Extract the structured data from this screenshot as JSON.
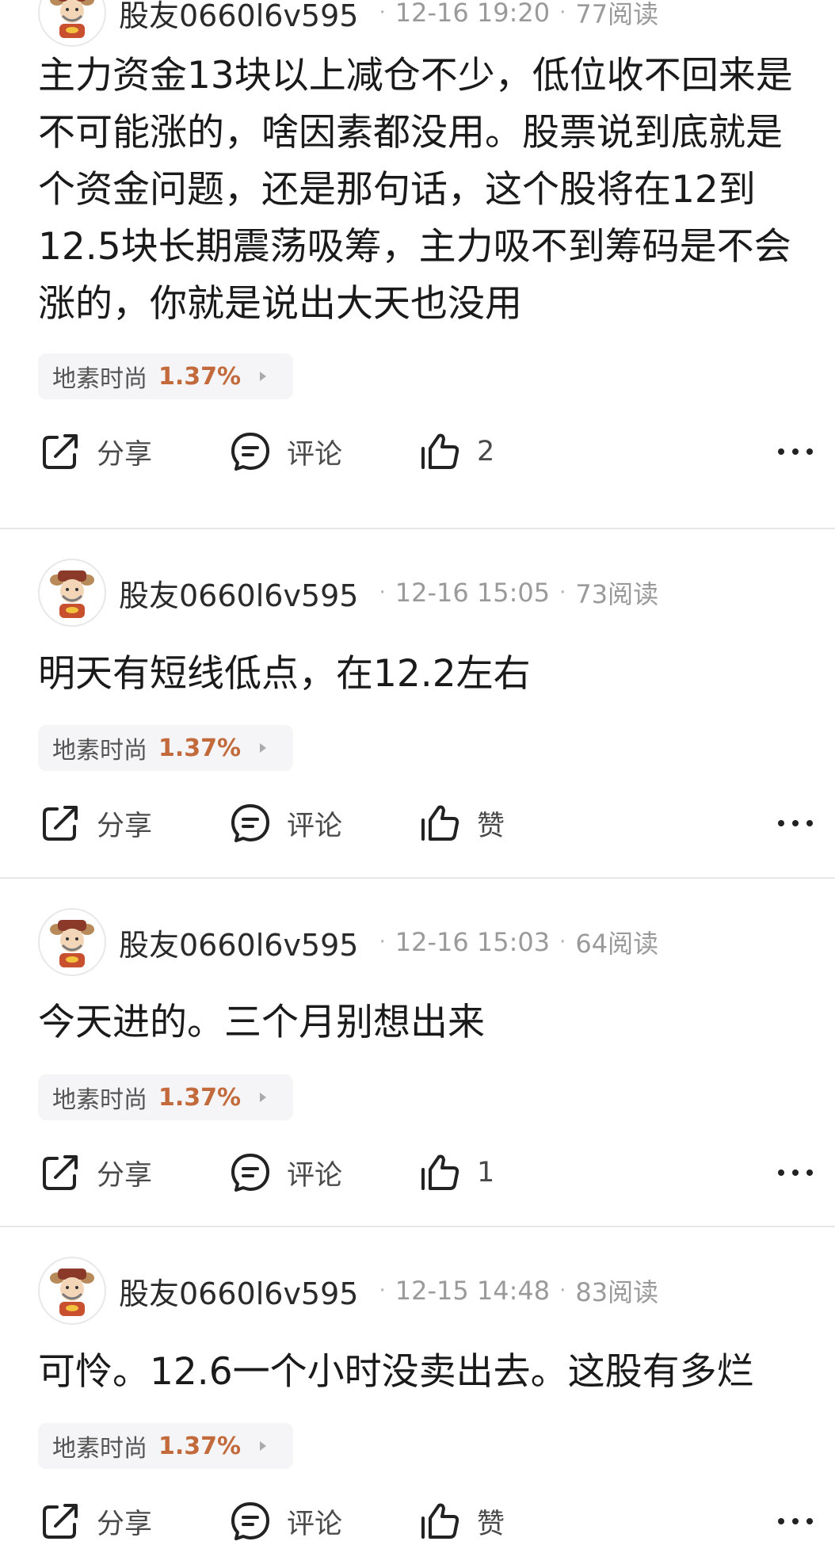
{
  "posts": [
    {
      "username": "股友0660l6v595",
      "time": "12-16 19:20",
      "reads": "77阅读",
      "content": "主力资金13块以上减仓不少，低位收不回来是不可能涨的，啥因素都没用。股票说到底就是个资金问题，还是那句话，这个股将在12到12.5块长期震荡吸筹，主力吸不到筹码是不会涨的，你就是说出大天也没用",
      "stock_name": "地素时尚",
      "stock_change": "1.37%",
      "share_label": "分享",
      "comment_label": "评论",
      "like_label": "2"
    },
    {
      "username": "股友0660l6v595",
      "time": "12-16 15:05",
      "reads": "73阅读",
      "content": "明天有短线低点，在12.2左右",
      "stock_name": "地素时尚",
      "stock_change": "1.37%",
      "share_label": "分享",
      "comment_label": "评论",
      "like_label": "赞"
    },
    {
      "username": "股友0660l6v595",
      "time": "12-16 15:03",
      "reads": "64阅读",
      "content": "今天进的。三个月别想出来",
      "stock_name": "地素时尚",
      "stock_change": "1.37%",
      "share_label": "分享",
      "comment_label": "评论",
      "like_label": "1"
    },
    {
      "username": "股友0660l6v595",
      "time": "12-15 14:48",
      "reads": "83阅读",
      "content": "可怜。12.6一个小时没卖出去。这股有多烂",
      "stock_name": "地素时尚",
      "stock_change": "1.37%",
      "share_label": "分享",
      "comment_label": "评论",
      "like_label": "赞"
    }
  ],
  "icons": {
    "share": "share-icon",
    "comment": "comment-icon",
    "like": "thumbs-up-icon",
    "more": "more-dots-icon",
    "avatar": "avatar-caishen-icon"
  },
  "colors": {
    "stock_change": "#c26a3b",
    "meta_text": "#9a9a9a",
    "divider": "#e6e6e6",
    "tag_bg": "#f5f5f7"
  }
}
